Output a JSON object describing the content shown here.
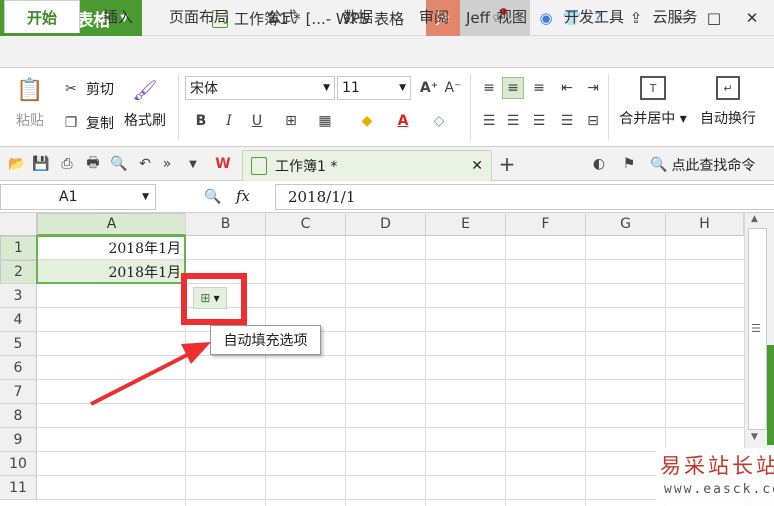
{
  "titlebar": {
    "app_name": "WPS 表格",
    "doc_title": "工作簿1 * [...- WPS 表格",
    "avatar_initials": "Je",
    "user_name": "Jeff"
  },
  "tabs": [
    "开始",
    "插入",
    "页面布局",
    "公式",
    "数据",
    "审阅",
    "视图",
    "开发工具",
    "云服务"
  ],
  "active_tab": "开始",
  "ribbon": {
    "paste": "粘贴",
    "cut": "剪切",
    "copy": "复制",
    "format_painter": "格式刷",
    "font_name": "宋体",
    "font_size": "11",
    "merge_center": "合并居中",
    "wrap_text": "自动换行"
  },
  "quickbar": {
    "doc_tab": "工作簿1 *",
    "search": "点此查找命令"
  },
  "formula_bar": {
    "name_box": "A1",
    "fx_label": "fx",
    "value": "2018/1/1"
  },
  "sheet": {
    "columns": [
      "A",
      "B",
      "C",
      "D",
      "E",
      "F",
      "G",
      "H"
    ],
    "rows": [
      "1",
      "2",
      "3",
      "4",
      "5",
      "6",
      "7",
      "8",
      "9",
      "10",
      "11"
    ],
    "cells": {
      "A1": "2018年1月",
      "A2": "2018年1月"
    }
  },
  "autofill_tooltip": "自动填充选项",
  "watermark": {
    "title": "易采站长站",
    "url": "www.easck.com"
  },
  "colors": {
    "brand": "#4a9a31",
    "selection": "#d9ead0",
    "annotation": "#ee2f2f"
  }
}
